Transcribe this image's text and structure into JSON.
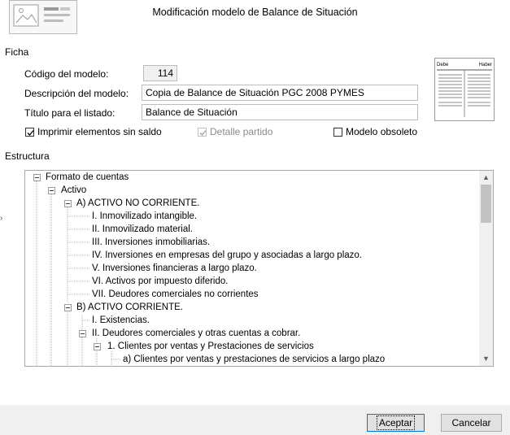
{
  "window": {
    "title": "Modificación  modelo de Balance de Situación"
  },
  "ficha": {
    "label": "Ficha",
    "codigo_label": "Código del modelo:",
    "codigo_value": "114",
    "descripcion_label": "Descripción del modelo:",
    "descripcion_value": "Copia de Balance de Situación PGC 2008 PYMES",
    "titulo_label": "Título para el listado:",
    "titulo_value": "Balance de Situación",
    "checks": {
      "imprimir": {
        "label": "Imprimir elementos sin saldo",
        "checked": true
      },
      "detalle": {
        "label": "Detalle partido",
        "checked": true,
        "disabled": true
      },
      "obsoleto": {
        "label": "Modelo obsoleto",
        "checked": false
      }
    },
    "preview": {
      "debe": "Debe",
      "haber": "Haber"
    }
  },
  "estructura": {
    "label": "Estructura",
    "nodes": [
      "Formato de cuentas",
      "Activo",
      "A) ACTIVO NO CORRIENTE.",
      "I. Inmovilizado intangible.",
      "II. Inmovilizado material.",
      "III. Inversiones inmobiliarias.",
      "IV. Inversiones en empresas del grupo y asociadas a largo plazo.",
      "V. Inversiones financieras a largo plazo.",
      "VI. Activos por impuesto diferido.",
      "VII. Deudores comerciales no corrientes",
      "B) ACTIVO CORRIENTE.",
      "I. Existencias.",
      "II. Deudores comerciales y otras cuentas a cobrar.",
      "1. Clientes por ventas y Prestaciones de servicios",
      "a) Clientes por ventas y prestaciones de servicios a largo plazo"
    ]
  },
  "buttons": {
    "accept": "Aceptar",
    "cancel": "Cancelar"
  },
  "colors": {
    "footer": "#f0f0f0",
    "accent": "#0078d7"
  }
}
